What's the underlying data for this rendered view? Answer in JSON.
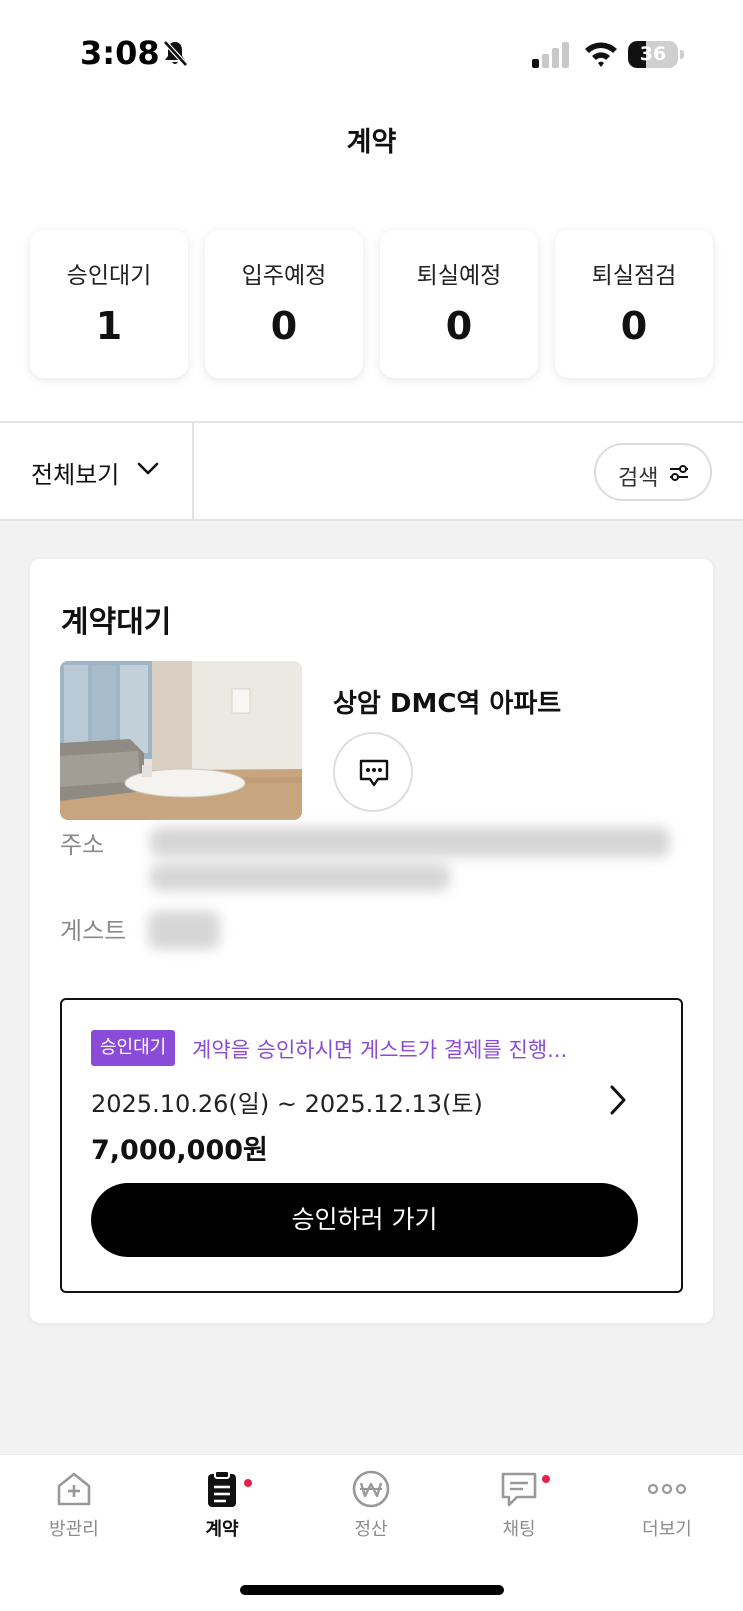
{
  "status_bar": {
    "time": "3:08",
    "battery": "36",
    "battery_level": 0.36
  },
  "header": {
    "title": "계약"
  },
  "stats": [
    {
      "label": "승인대기",
      "value": "1"
    },
    {
      "label": "입주예정",
      "value": "0"
    },
    {
      "label": "퇴실예정",
      "value": "0"
    },
    {
      "label": "퇴실점검",
      "value": "0"
    }
  ],
  "filter": {
    "view_all_label": "전체보기",
    "search_label": "검색"
  },
  "contract_card": {
    "section_title": "계약대기",
    "property_name": "상암 DMC역 아파트",
    "address_label": "주소",
    "guest_label": "게스트",
    "status_badge": "승인대기",
    "notice": "계약을 승인하시면 게스트가 결제를 진행...",
    "dates": "2025.10.26(일) ~ 2025.12.13(토)",
    "price": "7,000,000원",
    "approve_button": "승인하러 가기"
  },
  "tabbar": {
    "items": [
      {
        "label": "방관리",
        "icon": "house-plus-icon",
        "active": false
      },
      {
        "label": "계약",
        "icon": "clipboard-icon",
        "active": true
      },
      {
        "label": "정산",
        "icon": "won-icon",
        "active": false
      },
      {
        "label": "채팅",
        "icon": "chat-icon",
        "active": false
      },
      {
        "label": "더보기",
        "icon": "more-icon",
        "active": false
      }
    ]
  },
  "colors": {
    "accent": "#8a4bd8",
    "notification_dot": "#e8214a",
    "primary_button": "#000000"
  }
}
